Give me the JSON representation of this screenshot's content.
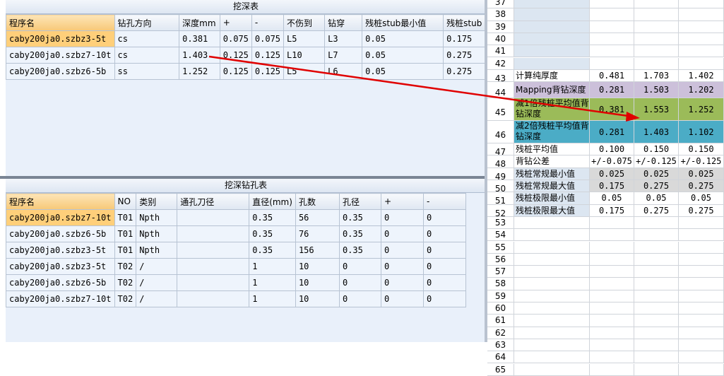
{
  "top_table": {
    "title": "挖深表",
    "headers": [
      "程序名",
      "钻孔方向",
      "深度mm",
      "+",
      "-",
      "不伤到",
      "钻穿",
      "残桩stub最小值",
      "残桩stub"
    ],
    "rows": [
      [
        "caby200ja0.szbz3-5t",
        "cs",
        "0.381",
        "0.075",
        "0.075",
        "L5",
        "L3",
        "0.05",
        "0.175"
      ],
      [
        "caby200ja0.szbz7-10t",
        "cs",
        "1.403",
        "0.125",
        "0.125",
        "L10",
        "L7",
        "0.05",
        "0.275"
      ],
      [
        "caby200ja0.szbz6-5b",
        "ss",
        "1.252",
        "0.125",
        "0.125",
        "L5",
        "L6",
        "0.05",
        "0.275"
      ]
    ]
  },
  "bottom_table": {
    "title": "挖深钻孔表",
    "headers": [
      "程序名",
      "NO",
      "类别",
      "通孔刀径",
      "直径(mm)",
      "孔数",
      "孔径",
      "+",
      "-"
    ],
    "rows": [
      [
        "caby200ja0.szbz7-10t",
        "T01",
        "Npth",
        "",
        "0.35",
        "56",
        "0.35",
        "0",
        "0"
      ],
      [
        "caby200ja0.szbz6-5b",
        "T01",
        "Npth",
        "",
        "0.35",
        "76",
        "0.35",
        "0",
        "0"
      ],
      [
        "caby200ja0.szbz3-5t",
        "T01",
        "Npth",
        "",
        "0.35",
        "156",
        "0.35",
        "0",
        "0"
      ],
      [
        "caby200ja0.szbz3-5t",
        "T02",
        "/",
        "",
        "1",
        "10",
        "0",
        "0",
        "0"
      ],
      [
        "caby200ja0.szbz6-5b",
        "T02",
        "/",
        "",
        "1",
        "10",
        "0",
        "0",
        "0"
      ],
      [
        "caby200ja0.szbz7-10t",
        "T02",
        "/",
        "",
        "1",
        "10",
        "0",
        "0",
        "0"
      ]
    ]
  },
  "sheet": {
    "empty_rows": [
      "37",
      "38",
      "39",
      "40",
      "41",
      "42"
    ],
    "data_rows": [
      {
        "num": "43",
        "label": "计算纯厚度",
        "values": [
          "0.481",
          "1.703",
          "1.402"
        ],
        "color": "#ffffff"
      },
      {
        "num": "44",
        "label": "Mapping背钻深度",
        "values": [
          "0.281",
          "1.503",
          "1.202"
        ],
        "color": "#ccc0da"
      },
      {
        "num": "45",
        "label": "减1倍残桩平均值背钻深度",
        "values": [
          "0.381",
          "1.553",
          "1.252"
        ],
        "color": "#9bbb59"
      },
      {
        "num": "46",
        "label": "减2倍残桩平均值背钻深度",
        "values": [
          "0.281",
          "1.403",
          "1.102"
        ],
        "color": "#4bacc6"
      },
      {
        "num": "47",
        "label": "残桩平均值",
        "values": [
          "0.100",
          "0.150",
          "0.150"
        ],
        "color": "#ffffff"
      },
      {
        "num": "48",
        "label": "背钻公差",
        "values": [
          "+/-0.075",
          "+/-0.125",
          "+/-0.125"
        ],
        "color": "#ffffff"
      },
      {
        "num": "49",
        "label": "残桩常规最小值",
        "values": [
          "0.025",
          "0.025",
          "0.025"
        ],
        "color": "#d9d9d9"
      },
      {
        "num": "50",
        "label": "残桩常规最大值",
        "values": [
          "0.175",
          "0.275",
          "0.275"
        ],
        "color": "#d9d9d9"
      },
      {
        "num": "51",
        "label": "残桩极限最小值",
        "values": [
          "0.05",
          "0.05",
          "0.05"
        ],
        "color": "#ffffff"
      },
      {
        "num": "52",
        "label": "残桩极限最大值",
        "values": [
          "0.175",
          "0.275",
          "0.275"
        ],
        "color": "#ffffff"
      }
    ],
    "trailing_rows": [
      "53",
      "54",
      "55",
      "56",
      "57",
      "58",
      "59",
      "60",
      "61",
      "62",
      "63",
      "64",
      "65"
    ],
    "label_bg": "#dce6f1",
    "arrow_color": "#e00000"
  }
}
